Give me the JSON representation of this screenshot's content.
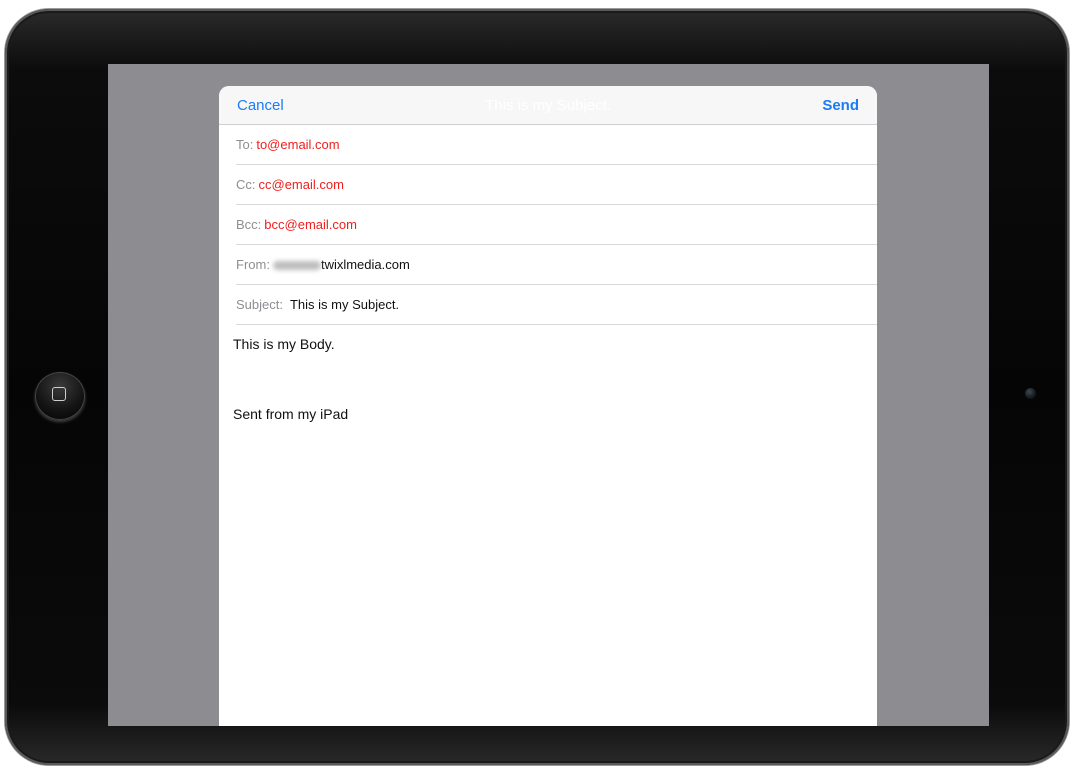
{
  "compose": {
    "cancel_label": "Cancel",
    "title": "This is my Subject.",
    "send_label": "Send"
  },
  "fields": {
    "to": {
      "label": "To:",
      "value": "to@email.com"
    },
    "cc": {
      "label": "Cc:",
      "value": "cc@email.com"
    },
    "bcc": {
      "label": "Bcc:",
      "value": "bcc@email.com"
    },
    "from": {
      "label": "From:",
      "value": "twixlmedia.com"
    },
    "subject": {
      "label": "Subject:",
      "value": "This is my Subject."
    }
  },
  "body": {
    "text": "This is my Body.",
    "signature": "Sent from my iPad"
  },
  "colors": {
    "accent": "#1a7cf6",
    "recipient": "#f0201f",
    "backdrop": "#8d8d91"
  },
  "icons": [
    "home-button-icon",
    "camera-icon"
  ]
}
